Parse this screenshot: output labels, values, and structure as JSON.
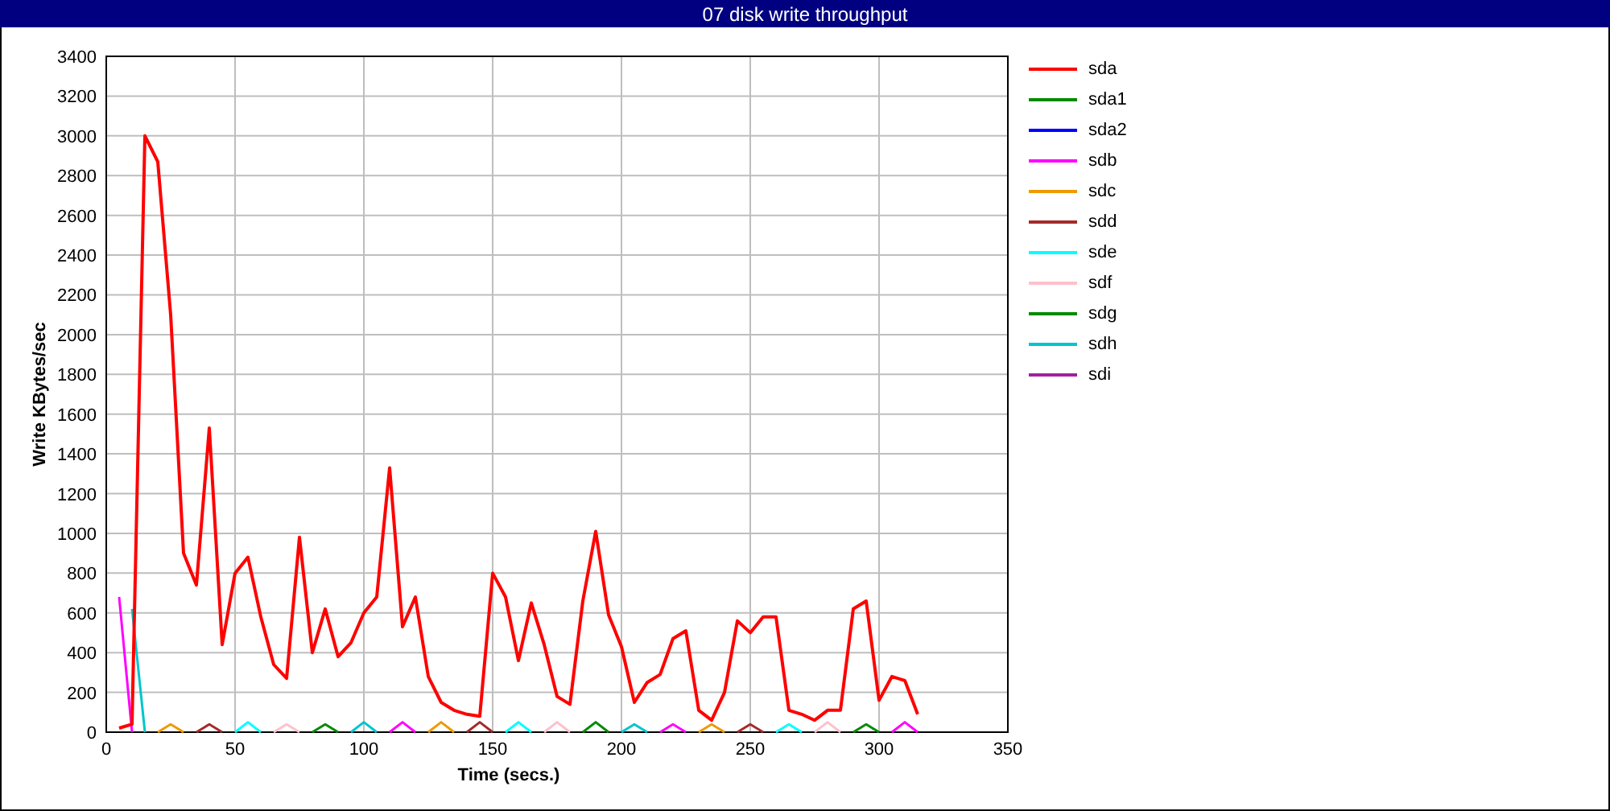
{
  "window": {
    "title": "07 disk write throughput"
  },
  "chart": {
    "chart_data": {
      "type": "line",
      "grid": true,
      "xlabel": "Time (secs.)",
      "ylabel": "Write KBytes/sec",
      "xlim": [
        0,
        350
      ],
      "ylim": [
        0,
        3400
      ],
      "xticks": [
        0,
        50,
        100,
        150,
        200,
        250,
        300,
        350
      ],
      "yticks": [
        0,
        200,
        400,
        600,
        800,
        1000,
        1200,
        1400,
        1600,
        1800,
        2000,
        2200,
        2400,
        2600,
        2800,
        3000,
        3200,
        3400
      ],
      "x": [
        5,
        10,
        15,
        20,
        25,
        30,
        35,
        40,
        45,
        50,
        55,
        60,
        65,
        70,
        75,
        80,
        85,
        90,
        95,
        100,
        105,
        110,
        115,
        120,
        125,
        130,
        135,
        140,
        145,
        150,
        155,
        160,
        165,
        170,
        175,
        180,
        185,
        190,
        195,
        200,
        205,
        210,
        215,
        220,
        225,
        230,
        235,
        240,
        245,
        250,
        255,
        260,
        265,
        270,
        275,
        280,
        285,
        290,
        295,
        300,
        305,
        310,
        315
      ],
      "series": [
        {
          "name": "sda",
          "color": "#ff0000",
          "values": [
            20,
            40,
            3000,
            2870,
            2100,
            900,
            740,
            1530,
            440,
            800,
            880,
            580,
            340,
            270,
            980,
            400,
            620,
            380,
            450,
            600,
            680,
            1330,
            530,
            680,
            280,
            150,
            110,
            90,
            80,
            800,
            680,
            360,
            650,
            440,
            180,
            140,
            660,
            1010,
            590,
            430,
            150,
            250,
            290,
            470,
            510,
            110,
            60,
            200,
            560,
            500,
            580,
            580,
            110,
            90,
            60,
            110,
            110,
            620,
            660,
            160,
            280,
            260,
            90
          ]
        },
        {
          "name": "sda1",
          "color": "#008b00",
          "values": [
            null,
            null,
            null,
            null,
            null,
            null,
            null,
            null,
            null,
            null,
            null,
            null,
            null,
            null,
            null,
            null,
            null,
            null,
            null,
            null,
            null,
            null,
            null,
            null,
            null,
            null,
            null,
            null,
            null,
            null,
            null,
            null,
            null,
            null,
            null,
            null,
            null,
            null,
            null,
            null,
            null,
            null,
            null,
            null,
            null,
            null,
            null,
            null,
            null,
            null,
            null,
            null,
            null,
            null,
            null,
            null,
            null,
            null,
            null,
            null,
            null,
            null,
            null
          ]
        },
        {
          "name": "sda2",
          "color": "#0000ff",
          "values": [
            null,
            null,
            null,
            null,
            null,
            null,
            null,
            null,
            null,
            null,
            null,
            null,
            null,
            null,
            null,
            null,
            null,
            null,
            null,
            null,
            null,
            null,
            null,
            null,
            null,
            null,
            null,
            null,
            null,
            null,
            null,
            null,
            null,
            null,
            null,
            null,
            null,
            null,
            null,
            null,
            null,
            null,
            null,
            null,
            null,
            null,
            null,
            null,
            null,
            null,
            null,
            null,
            null,
            null,
            null,
            null,
            null,
            null,
            null,
            null,
            null,
            null,
            null
          ]
        },
        {
          "name": "sdb",
          "color": "#ff00ff",
          "values": [
            680,
            0,
            null,
            null,
            null,
            null,
            null,
            null,
            null,
            null,
            null,
            null,
            null,
            null,
            null,
            null,
            null,
            null,
            null,
            null,
            null,
            0,
            50,
            0,
            null,
            null,
            null,
            null,
            null,
            null,
            null,
            null,
            null,
            null,
            null,
            null,
            null,
            null,
            null,
            null,
            null,
            null,
            0,
            40,
            0,
            null,
            null,
            null,
            null,
            null,
            null,
            null,
            null,
            null,
            null,
            null,
            null,
            null,
            null,
            null,
            0,
            50,
            0
          ]
        },
        {
          "name": "sdc",
          "color": "#ee9a00",
          "values": [
            null,
            null,
            null,
            0,
            40,
            0,
            null,
            null,
            null,
            null,
            null,
            null,
            null,
            null,
            null,
            null,
            null,
            null,
            null,
            null,
            null,
            null,
            null,
            null,
            0,
            50,
            0,
            null,
            null,
            null,
            null,
            null,
            null,
            null,
            null,
            null,
            null,
            null,
            null,
            null,
            null,
            null,
            null,
            null,
            null,
            0,
            40,
            0,
            null,
            null,
            null,
            null,
            null,
            null,
            null,
            null,
            null,
            null,
            null,
            null,
            null,
            null,
            null
          ]
        },
        {
          "name": "sdd",
          "color": "#a52a2a",
          "values": [
            null,
            null,
            null,
            null,
            null,
            null,
            0,
            40,
            0,
            null,
            null,
            null,
            null,
            null,
            null,
            null,
            null,
            null,
            null,
            null,
            null,
            null,
            null,
            null,
            null,
            null,
            null,
            0,
            50,
            0,
            null,
            null,
            null,
            null,
            null,
            null,
            null,
            null,
            null,
            null,
            null,
            null,
            null,
            null,
            null,
            null,
            null,
            null,
            0,
            40,
            0,
            null,
            null,
            null,
            null,
            null,
            null,
            null,
            null,
            null,
            null,
            null,
            null
          ]
        },
        {
          "name": "sde",
          "color": "#00ffff",
          "values": [
            null,
            null,
            null,
            null,
            null,
            null,
            null,
            null,
            null,
            0,
            50,
            0,
            null,
            null,
            null,
            null,
            null,
            null,
            null,
            null,
            null,
            null,
            null,
            null,
            null,
            null,
            null,
            null,
            null,
            null,
            0,
            50,
            0,
            null,
            null,
            null,
            null,
            null,
            null,
            null,
            null,
            null,
            null,
            null,
            null,
            null,
            null,
            null,
            null,
            null,
            null,
            0,
            40,
            0,
            null,
            null,
            null,
            null,
            null,
            null,
            null,
            null,
            null
          ]
        },
        {
          "name": "sdf",
          "color": "#ffc0cb",
          "values": [
            null,
            null,
            null,
            null,
            null,
            null,
            null,
            null,
            null,
            null,
            null,
            null,
            0,
            40,
            0,
            null,
            null,
            null,
            null,
            null,
            null,
            null,
            null,
            null,
            null,
            null,
            null,
            null,
            null,
            null,
            null,
            null,
            null,
            0,
            50,
            0,
            null,
            null,
            null,
            null,
            null,
            null,
            null,
            null,
            null,
            null,
            null,
            null,
            null,
            null,
            null,
            null,
            null,
            null,
            0,
            50,
            0,
            null,
            null,
            null,
            null,
            null,
            null
          ]
        },
        {
          "name": "sdg",
          "color": "#008b00",
          "values": [
            null,
            null,
            null,
            null,
            null,
            null,
            null,
            null,
            null,
            null,
            null,
            null,
            null,
            null,
            null,
            0,
            40,
            0,
            null,
            null,
            null,
            null,
            null,
            null,
            null,
            null,
            null,
            null,
            null,
            null,
            null,
            null,
            null,
            null,
            null,
            null,
            0,
            50,
            0,
            null,
            null,
            null,
            null,
            null,
            null,
            null,
            null,
            null,
            null,
            null,
            null,
            null,
            null,
            null,
            null,
            null,
            null,
            0,
            40,
            0,
            null,
            null,
            null
          ]
        },
        {
          "name": "sdh",
          "color": "#00c5cd",
          "values": [
            null,
            620,
            0,
            null,
            null,
            null,
            null,
            null,
            null,
            null,
            null,
            null,
            null,
            null,
            null,
            null,
            null,
            null,
            0,
            50,
            0,
            null,
            null,
            null,
            null,
            null,
            null,
            null,
            null,
            null,
            null,
            null,
            null,
            null,
            null,
            null,
            null,
            null,
            null,
            0,
            40,
            0,
            null,
            null,
            null,
            null,
            null,
            null,
            null,
            null,
            null,
            null,
            null,
            null,
            null,
            null,
            null,
            null,
            null,
            null,
            null,
            null,
            null
          ]
        },
        {
          "name": "sdi",
          "color": "#a020a0",
          "values": [
            null,
            null,
            null,
            null,
            null,
            null,
            null,
            null,
            null,
            null,
            null,
            null,
            null,
            null,
            null,
            null,
            null,
            null,
            null,
            null,
            null,
            null,
            null,
            null,
            null,
            null,
            null,
            null,
            null,
            null,
            null,
            null,
            null,
            null,
            null,
            null,
            null,
            null,
            null,
            null,
            null,
            null,
            null,
            null,
            null,
            null,
            null,
            null,
            null,
            null,
            null,
            null,
            null,
            null,
            null,
            null,
            null,
            null,
            null,
            null,
            null,
            null,
            null
          ]
        }
      ]
    }
  }
}
